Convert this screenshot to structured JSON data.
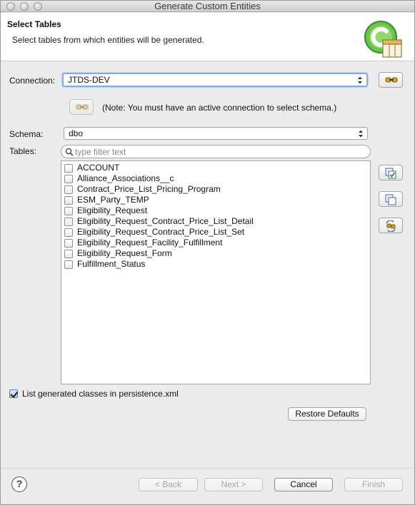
{
  "window": {
    "title": "Generate Custom Entities"
  },
  "header": {
    "title": "Select Tables",
    "description": "Select tables from which entities will be generated."
  },
  "connection": {
    "label": "Connection:",
    "value": "JTDS-DEV"
  },
  "note": "(Note: You must have an active connection to select schema.)",
  "schema": {
    "label": "Schema:",
    "value": "dbo"
  },
  "tables": {
    "label": "Tables:",
    "filter_placeholder": "type filter text",
    "items": [
      {
        "name": "ACCOUNT",
        "checked": false
      },
      {
        "name": "Alliance_Associations__c",
        "checked": false
      },
      {
        "name": "Contract_Price_List_Pricing_Program",
        "checked": false
      },
      {
        "name": "ESM_Party_TEMP",
        "checked": false
      },
      {
        "name": "Eligibility_Request",
        "checked": false
      },
      {
        "name": "Eligibility_Request_Contract_Price_List_Detail",
        "checked": false
      },
      {
        "name": "Eligibility_Request_Contract_Price_List_Set",
        "checked": false
      },
      {
        "name": "Eligibility_Request_Facility_Fulfillment",
        "checked": false
      },
      {
        "name": "Eligibility_Request_Form",
        "checked": false
      },
      {
        "name": "Fulfillment_Status",
        "checked": false
      }
    ]
  },
  "persistence": {
    "label": "List generated classes in persistence.xml",
    "checked": true
  },
  "buttons": {
    "restore_defaults": "Restore Defaults",
    "back": "< Back",
    "next": "Next >",
    "cancel": "Cancel",
    "finish": "Finish"
  },
  "icons": {
    "connect": "connect-icon",
    "reconnect": "reconnect-icon",
    "select_all": "select-all-icon",
    "deselect_all": "deselect-all-icon",
    "refresh": "refresh-icon",
    "help": "help-icon",
    "search": "search-icon",
    "wizard": "wizard-banner-icon"
  },
  "help_glyph": "?"
}
